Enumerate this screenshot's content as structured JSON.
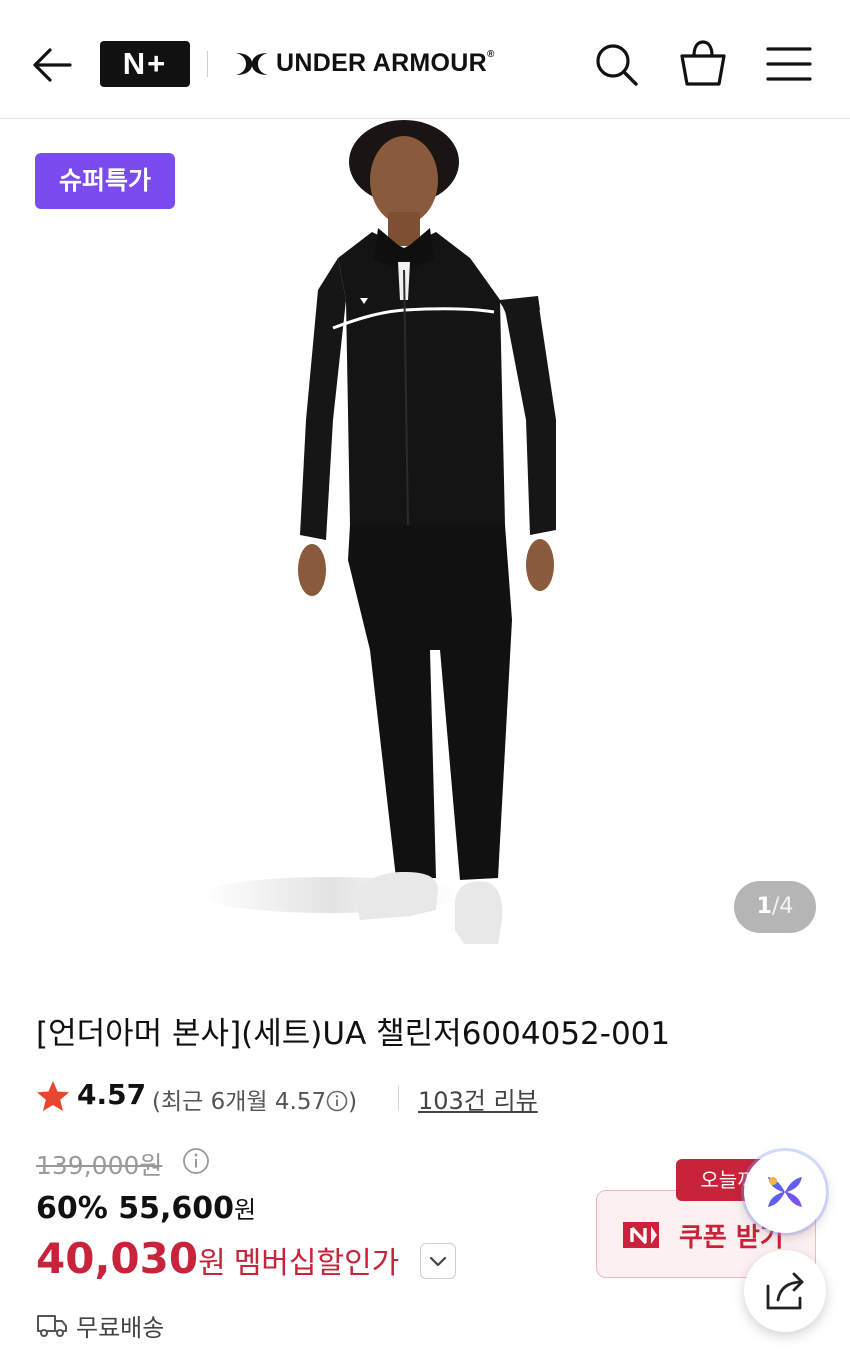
{
  "header": {
    "partner_logo": "N+",
    "brand_name": "UNDER ARMOUR",
    "brand_registered": "®",
    "icons": [
      "back-arrow-icon",
      "search-icon",
      "shopping-bag-icon",
      "hamburger-menu-icon"
    ]
  },
  "hero": {
    "badge": "슈퍼특가",
    "image_counter": {
      "current": "1",
      "separator": "/",
      "total": "4"
    }
  },
  "product": {
    "title": "[언더아머 본사](세트)UA 챌린저6004052-001",
    "rating": {
      "score": "4.57",
      "recent_prefix": "(최근 6개월 4.57",
      "recent_suffix": ")",
      "reviews": "103건 리뷰"
    },
    "price": {
      "original": "139,000원",
      "discount_rate": "60%",
      "discount_price": "55,600",
      "discount_won": "원",
      "member_price": "40,030",
      "member_won": "원",
      "member_label": "멤버십할인가"
    },
    "shipping": "무료배송"
  },
  "coupon": {
    "tag": "오늘까",
    "button": "쿠폰 받기",
    "logo": "N"
  },
  "colors": {
    "badge_purple": "#7a4cf0",
    "price_red": "#c8233b",
    "star_red": "#e8452c",
    "text_dark": "#111111"
  }
}
